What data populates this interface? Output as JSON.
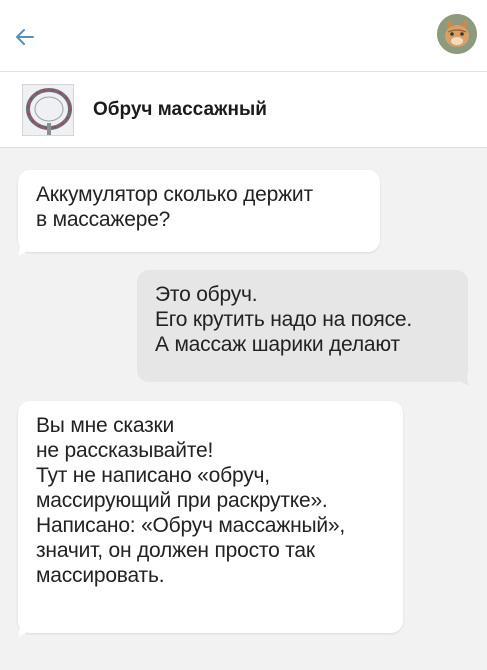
{
  "header": {
    "back_icon": "arrow-left-icon",
    "accent": "#5a8fb8"
  },
  "product": {
    "title": "Обруч массажный",
    "thumbnail_icon": "hoop-thumbnail"
  },
  "messages": [
    {
      "direction": "incoming",
      "text": "Аккумулятор сколько держит\nв массажере?"
    },
    {
      "direction": "outgoing",
      "text": "Это обруч.\nЕго крутить надо на поясе.\nА массаж шарики делают"
    },
    {
      "direction": "incoming",
      "text": "Вы мне сказки\nне рассказывайте!\nТут не написано «обруч,\nмассирующий при раскрутке».\nНаписано: «Обруч массажный»,\nзначит, он должен просто так\nмассировать."
    }
  ]
}
